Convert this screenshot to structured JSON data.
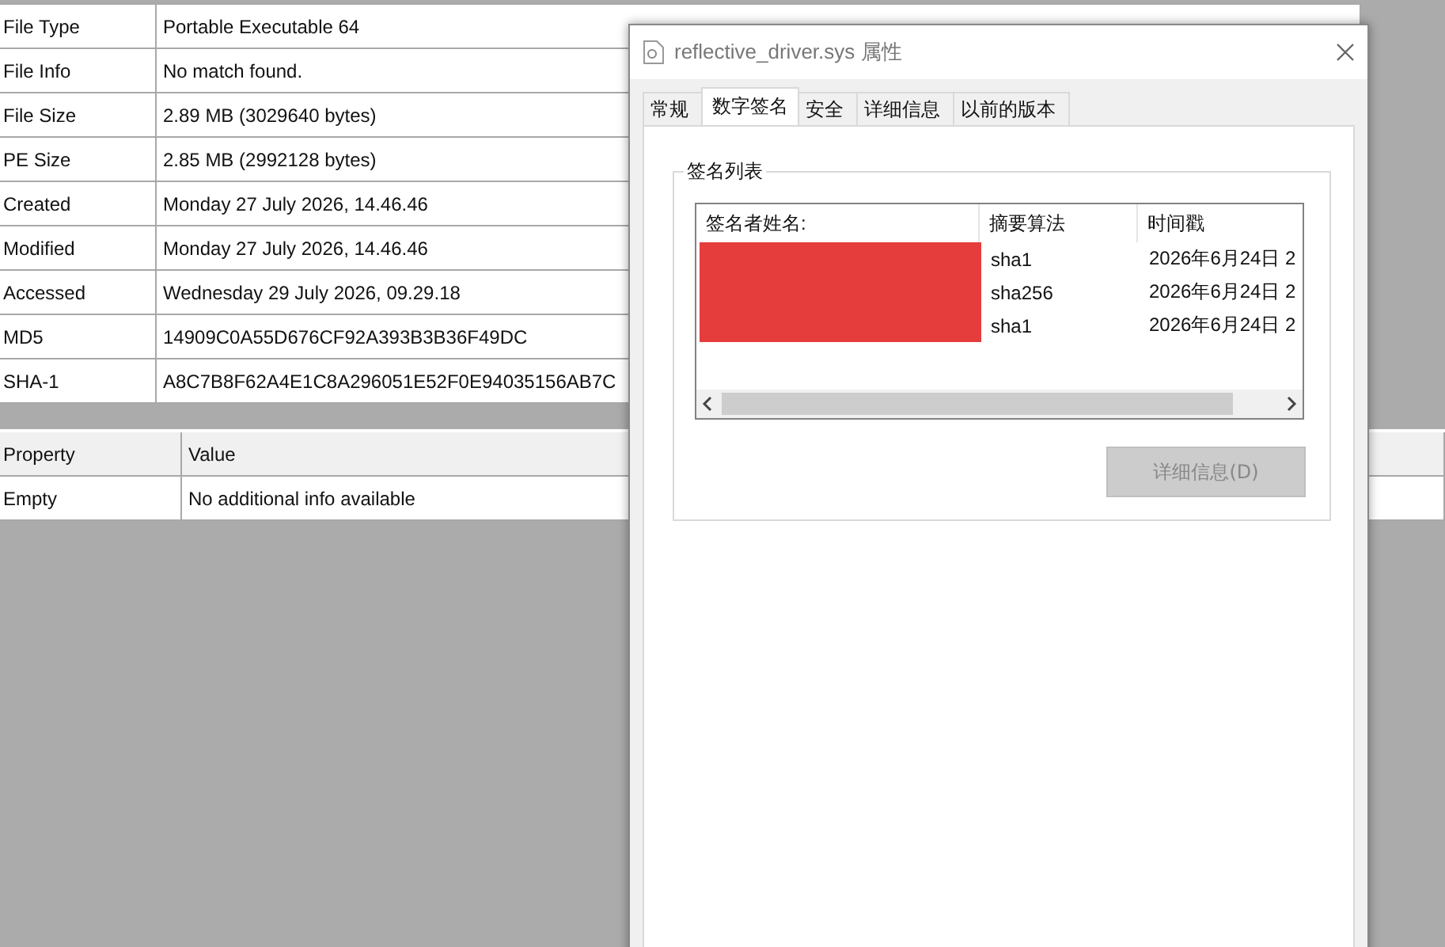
{
  "file_info": [
    {
      "label": "File Type",
      "value": "Portable Executable 64"
    },
    {
      "label": "File Info",
      "value": "No match found."
    },
    {
      "label": "File Size",
      "value": "2.89 MB (3029640 bytes)"
    },
    {
      "label": "PE Size",
      "value": "2.85 MB (2992128 bytes)"
    },
    {
      "label": "Created",
      "value": "Monday 27 July 2026, 14.46.46"
    },
    {
      "label": "Modified",
      "value": "Monday 27 July 2026, 14.46.46"
    },
    {
      "label": "Accessed",
      "value": "Wednesday 29 July 2026, 09.29.18"
    },
    {
      "label": "MD5",
      "value": "14909C0A55D676CF92A393B3B36F49DC"
    },
    {
      "label": "SHA-1",
      "value": "A8C7B8F62A4E1C8A296051E52F0E94035156AB7C"
    }
  ],
  "properties_table": {
    "columns": [
      "Property",
      "Value"
    ],
    "rows": [
      [
        "Empty",
        "No additional info available"
      ]
    ]
  },
  "dialog": {
    "title": "reflective_driver.sys 属性",
    "tabs": [
      {
        "label": "常规",
        "selected": false
      },
      {
        "label": "数字签名",
        "selected": true
      },
      {
        "label": "安全",
        "selected": false
      },
      {
        "label": "详细信息",
        "selected": false
      },
      {
        "label": "以前的版本",
        "selected": false
      }
    ],
    "group_title": "签名列表",
    "signatures": {
      "columns": [
        "签名者姓名:",
        "摘要算法",
        "时间戳"
      ],
      "rows": [
        {
          "digest": "sha1",
          "timestamp": "2026年6月24日 2"
        },
        {
          "digest": "sha256",
          "timestamp": "2026年6月24日 2"
        },
        {
          "digest": "sha1",
          "timestamp": "2026年6月24日 2"
        }
      ]
    },
    "details_button": {
      "label": "详细信息(D)",
      "disabled": true
    }
  }
}
